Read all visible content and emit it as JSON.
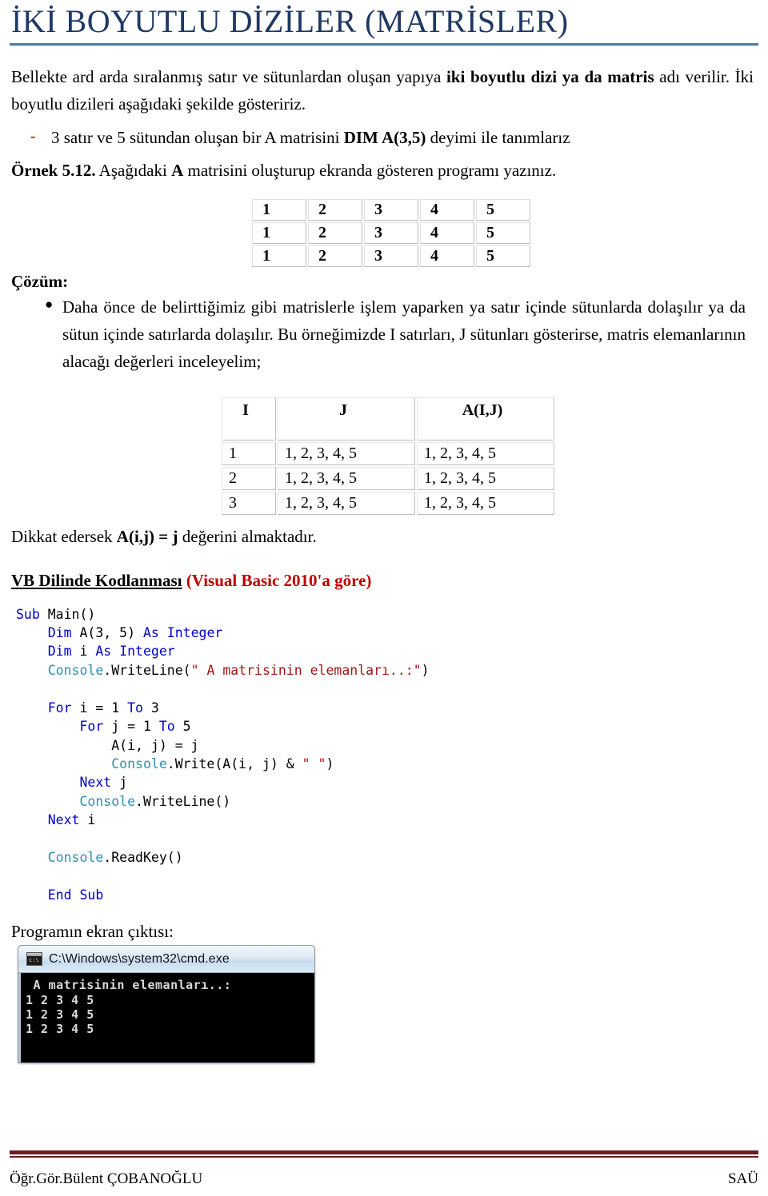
{
  "title": "İKİ BOYUTLU DİZİLER (MATRİSLER)",
  "intro": {
    "part1": "Bellekte ard arda sıralanmış satır ve sütunlardan oluşan yapıya ",
    "bold1": "iki boyutlu dizi ya da matris",
    "part2": " adı verilir. İki boyutlu dizileri aşağıdaki şekilde gösteririz."
  },
  "dash_item": {
    "marker": "-",
    "part1": "3 satır ve 5 sütundan oluşan bir A matrisini ",
    "bold1": "DIM A(3,5)",
    "part2": " deyimi ile tanımlarız"
  },
  "ornek": {
    "bold1": "Örnek 5.12.",
    "part1": " Aşağıdaki ",
    "bold2": "A",
    "part2": " matrisini oluşturup ekranda gösteren programı yazınız."
  },
  "matrix": {
    "rows": [
      [
        "1",
        "2",
        "3",
        "4",
        "5"
      ],
      [
        "1",
        "2",
        "3",
        "4",
        "5"
      ],
      [
        "1",
        "2",
        "3",
        "4",
        "5"
      ]
    ]
  },
  "cozum": {
    "label": "Çözüm:",
    "bullet_marker": "●",
    "text": "Daha önce de belirttiğimiz gibi matrislerle işlem yaparken ya satır içinde sütunlarda dolaşılır ya da sütun içinde satırlarda dolaşılır. Bu örneğimizde I satırları, J sütunları gösterirse, matris elemanlarının alacağı değerleri inceleyelim;"
  },
  "ij_table": {
    "headers": [
      "I",
      "J",
      "A(I,J)"
    ],
    "rows": [
      [
        "1",
        "1, 2, 3, 4, 5",
        "1, 2, 3, 4, 5"
      ],
      [
        "2",
        "1, 2, 3, 4, 5",
        "1, 2, 3, 4, 5"
      ],
      [
        "3",
        "1, 2, 3, 4, 5",
        "1, 2, 3, 4, 5"
      ]
    ]
  },
  "dikkat": {
    "part1": "Dikkat edersek ",
    "bold1": "A(i,j) = j",
    "part2": " değerini almaktadır."
  },
  "vb_heading": {
    "black": "VB Dilinde Kodlanması",
    "red": " (Visual Basic 2010'a göre)"
  },
  "code": {
    "lines": [
      {
        "indent": 0,
        "tokens": [
          {
            "t": "Sub",
            "c": "kw"
          },
          {
            "t": " Main()",
            "c": ""
          }
        ]
      },
      {
        "indent": 1,
        "tokens": [
          {
            "t": "Dim",
            "c": "kw"
          },
          {
            "t": " A(3, 5) ",
            "c": ""
          },
          {
            "t": "As",
            "c": "kw"
          },
          {
            "t": " ",
            "c": ""
          },
          {
            "t": "Integer",
            "c": "kw"
          }
        ]
      },
      {
        "indent": 1,
        "tokens": [
          {
            "t": "Dim",
            "c": "kw"
          },
          {
            "t": " i ",
            "c": ""
          },
          {
            "t": "As",
            "c": "kw"
          },
          {
            "t": " ",
            "c": ""
          },
          {
            "t": "Integer",
            "c": "kw"
          }
        ]
      },
      {
        "indent": 1,
        "tokens": [
          {
            "t": "Console",
            "c": "cls"
          },
          {
            "t": ".WriteLine(",
            "c": ""
          },
          {
            "t": "\" A matrisinin elemanları..:\"",
            "c": "str"
          },
          {
            "t": ")",
            "c": ""
          }
        ]
      },
      {
        "indent": 0,
        "tokens": []
      },
      {
        "indent": 1,
        "tokens": [
          {
            "t": "For",
            "c": "kw"
          },
          {
            "t": " i = 1 ",
            "c": ""
          },
          {
            "t": "To",
            "c": "kw"
          },
          {
            "t": " 3",
            "c": ""
          }
        ]
      },
      {
        "indent": 2,
        "tokens": [
          {
            "t": "For",
            "c": "kw"
          },
          {
            "t": " j = 1 ",
            "c": ""
          },
          {
            "t": "To",
            "c": "kw"
          },
          {
            "t": " 5",
            "c": ""
          }
        ]
      },
      {
        "indent": 3,
        "tokens": [
          {
            "t": "A(i, j) = j",
            "c": ""
          }
        ]
      },
      {
        "indent": 3,
        "tokens": [
          {
            "t": "Console",
            "c": "cls"
          },
          {
            "t": ".Write(A(i, j) & ",
            "c": ""
          },
          {
            "t": "\" \"",
            "c": "str"
          },
          {
            "t": ")",
            "c": ""
          }
        ]
      },
      {
        "indent": 2,
        "tokens": [
          {
            "t": "Next",
            "c": "kw"
          },
          {
            "t": " j",
            "c": ""
          }
        ]
      },
      {
        "indent": 2,
        "tokens": [
          {
            "t": "Console",
            "c": "cls"
          },
          {
            "t": ".WriteLine()",
            "c": ""
          }
        ]
      },
      {
        "indent": 1,
        "tokens": [
          {
            "t": "Next",
            "c": "kw"
          },
          {
            "t": " i",
            "c": ""
          }
        ]
      },
      {
        "indent": 0,
        "tokens": []
      },
      {
        "indent": 1,
        "tokens": [
          {
            "t": "Console",
            "c": "cls"
          },
          {
            "t": ".ReadKey()",
            "c": ""
          }
        ]
      },
      {
        "indent": 0,
        "tokens": []
      },
      {
        "indent": 0,
        "tokens": [
          {
            "t": "    ",
            "c": ""
          },
          {
            "t": "End",
            "c": "kw"
          },
          {
            "t": " ",
            "c": ""
          },
          {
            "t": "Sub",
            "c": "kw"
          }
        ]
      }
    ]
  },
  "output": {
    "label": "Programın ekran çıktısı:",
    "window_title": "C:\\Windows\\system32\\cmd.exe",
    "icon": "cmd-icon",
    "lines": [
      " A matrisinin elemanları..:",
      "1 2 3 4 5",
      "1 2 3 4 5",
      "1 2 3 4 5"
    ]
  },
  "footer": {
    "left": "Öğr.Gör.Bülent ÇOBANOĞLU",
    "right": "SAÜ"
  },
  "colors": {
    "title": "#1F3864",
    "title_rule": "#4A7BA7",
    "accent_red": "#C00000",
    "footer_rule": "#6B2020",
    "code_keyword": "#0000CC",
    "code_class": "#2B91AF",
    "code_string": "#A31515"
  }
}
